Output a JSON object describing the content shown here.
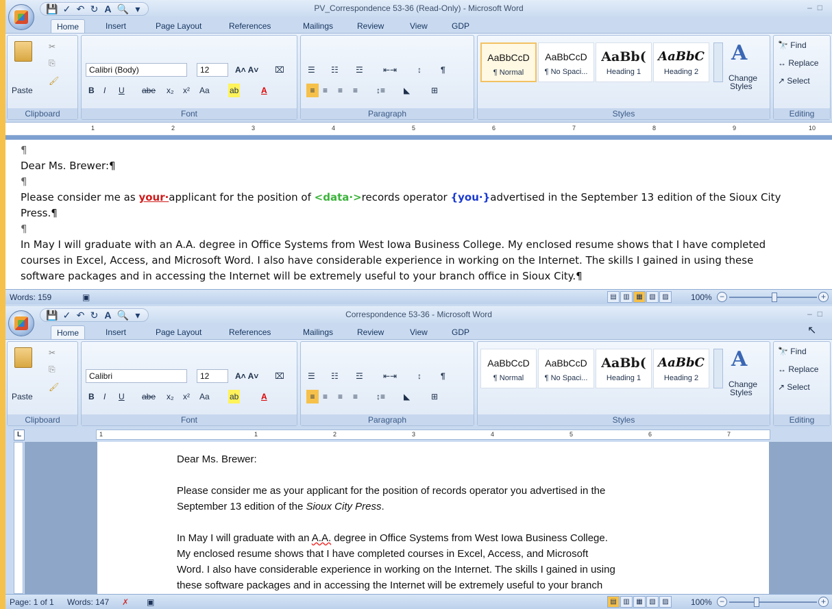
{
  "window1": {
    "title": "PV_Correspondence 53-36 (Read-Only) - Microsoft Word",
    "tabs": [
      "Home",
      "Insert",
      "Page Layout",
      "References",
      "Mailings",
      "Review",
      "View",
      "GDP"
    ],
    "font_name": "Calibri (Body)",
    "font_size": "12",
    "draft": {
      "pilcrow": "¶",
      "salutation": "Dear Ms. Brewer:¶",
      "p1_a": "Please consider me as ",
      "p1_your": "your·",
      "p1_b": "applicant for the position of ",
      "p1_data": "<data·>",
      "p1_c": "records operator ",
      "p1_you": "{you·}",
      "p1_d": "advertised in the September 13 edition of the Sioux City",
      "p1_e": "Press.¶",
      "p2_l1": "In May I will graduate with an A.A. degree in Office Systems from West Iowa Business College. My enclosed resume shows that I have completed",
      "p2_l2": "courses in Excel, Access, and Microsoft Word. I also have considerable experience in working on the Internet. The skills I gained in using these",
      "p2_l3": "software packages and in accessing the Internet will be extremely useful to your branch office in Sioux City.¶"
    },
    "status": {
      "words": "Words: 159",
      "zoom": "100%"
    }
  },
  "window2": {
    "title": "Correspondence 53-36 - Microsoft Word",
    "tabs": [
      "Home",
      "Insert",
      "Page Layout",
      "References",
      "Mailings",
      "Review",
      "View",
      "GDP"
    ],
    "font_name": "Calibri",
    "font_size": "12",
    "page": {
      "salutation": "Dear Ms. Brewer:",
      "p1_l1": "Please consider me as your applicant for the position of records operator you advertised in the",
      "p1_l2a": "September 13 edition of the ",
      "p1_l2b": "Sioux City Press",
      "p1_l2c": ".",
      "p2_l1a": "In May I will graduate with an ",
      "p2_l1b": "A.A.",
      "p2_l1c": " degree in Office Systems from West Iowa Business College.",
      "p2_l2": "My enclosed resume shows that I have completed courses in Excel, Access, and Microsoft",
      "p2_l3": "Word. I also have considerable experience in working on the Internet. The skills I gained in using",
      "p2_l4": "these software packages and in accessing the Internet will be extremely useful to your branch"
    },
    "status": {
      "page": "Page: 1 of 1",
      "words": "Words: 147",
      "zoom": "100%"
    }
  },
  "ribbon": {
    "clipboard_label": "Clipboard",
    "paste_label": "Paste",
    "font_label": "Font",
    "paragraph_label": "Paragraph",
    "styles_label": "Styles",
    "editing_label": "Editing",
    "styles": [
      {
        "sample": "AaBbCcD",
        "name": "¶ Normal"
      },
      {
        "sample": "AaBbCcD",
        "name": "¶ No Spaci..."
      },
      {
        "sample": "AaBb(",
        "name": "Heading 1"
      },
      {
        "sample": "AaBbC",
        "name": "Heading 2"
      }
    ],
    "change_styles_1": "Change",
    "change_styles_2": "Styles",
    "find": "Find",
    "replace": "Replace",
    "select": "Select",
    "font_buttons": [
      "B",
      "I",
      "U",
      "abe",
      "x₂",
      "x²",
      "Aa"
    ]
  },
  "ruler1_nums": [
    "1",
    "2",
    "3",
    "4",
    "5",
    "6",
    "7",
    "8",
    "9",
    "10"
  ],
  "ruler2_nums": [
    "1",
    "1",
    "2",
    "3",
    "4",
    "5",
    "6",
    "7"
  ]
}
